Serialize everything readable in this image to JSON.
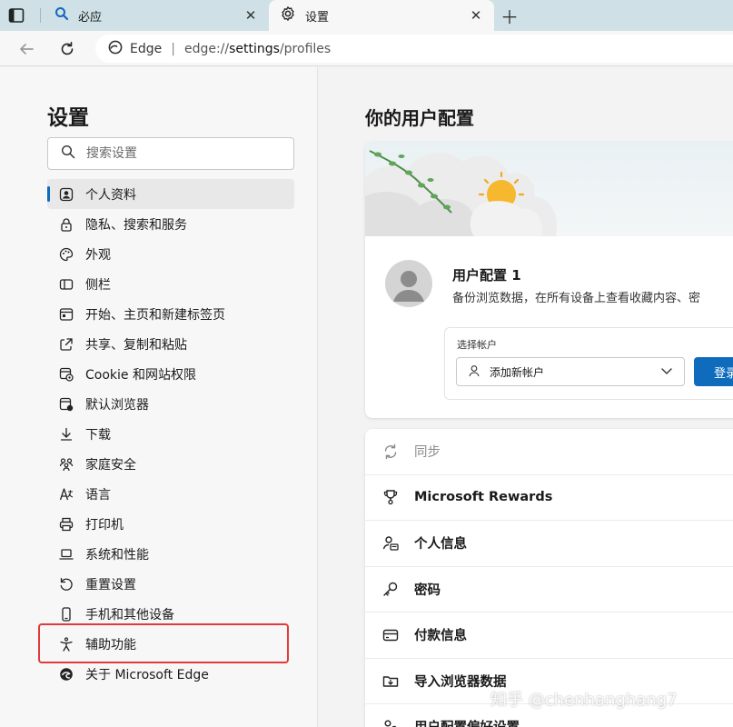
{
  "tabs": [
    {
      "title": "必应",
      "icon": "search-icon"
    },
    {
      "title": "设置",
      "icon": "gear-icon"
    }
  ],
  "address": {
    "edge_label": "Edge",
    "separator": "|",
    "url_prefix": "edge://",
    "url_path": "settings",
    "url_suffix": "/profiles"
  },
  "sidebar": {
    "title": "设置",
    "search_placeholder": "搜索设置",
    "items": [
      {
        "label": "个人资料",
        "icon": "profile-icon",
        "selected": true
      },
      {
        "label": "隐私、搜索和服务",
        "icon": "lock-icon"
      },
      {
        "label": "外观",
        "icon": "palette-icon"
      },
      {
        "label": "侧栏",
        "icon": "sidebar-icon"
      },
      {
        "label": "开始、主页和新建标签页",
        "icon": "home-icon"
      },
      {
        "label": "共享、复制和粘贴",
        "icon": "share-icon"
      },
      {
        "label": "Cookie 和网站权限",
        "icon": "cookie-icon"
      },
      {
        "label": "默认浏览器",
        "icon": "browser-icon"
      },
      {
        "label": "下载",
        "icon": "download-icon"
      },
      {
        "label": "家庭安全",
        "icon": "family-icon"
      },
      {
        "label": "语言",
        "icon": "language-icon"
      },
      {
        "label": "打印机",
        "icon": "printer-icon"
      },
      {
        "label": "系统和性能",
        "icon": "laptop-icon"
      },
      {
        "label": "重置设置",
        "icon": "reset-icon"
      },
      {
        "label": "手机和其他设备",
        "icon": "phone-icon"
      },
      {
        "label": "辅助功能",
        "icon": "accessibility-icon"
      },
      {
        "label": "关于 Microsoft Edge",
        "icon": "edge-logo-icon"
      }
    ]
  },
  "main": {
    "title": "你的用户配置",
    "profile": {
      "name": "用户配置 1",
      "description": "备份浏览数据，在所有设备上查看收藏内容、密",
      "account_label": "选择帐户",
      "account_select": "添加新帐户",
      "signin_label": "登录"
    },
    "list": [
      {
        "label": "同步",
        "icon": "sync-icon",
        "disabled": true
      },
      {
        "label": "Microsoft Rewards",
        "icon": "trophy-icon"
      },
      {
        "label": "个人信息",
        "icon": "person-info-icon"
      },
      {
        "label": "密码",
        "icon": "key-icon"
      },
      {
        "label": "付款信息",
        "icon": "card-icon"
      },
      {
        "label": "导入浏览器数据",
        "icon": "import-icon"
      },
      {
        "label": "用户配置偏好设置",
        "icon": "preferences-icon"
      }
    ]
  },
  "watermark": "知乎 @chenhanghang7",
  "colors": {
    "accent": "#0f6cbd",
    "highlight": "#e23a3a",
    "tabstrip": "#cfe1e6"
  }
}
